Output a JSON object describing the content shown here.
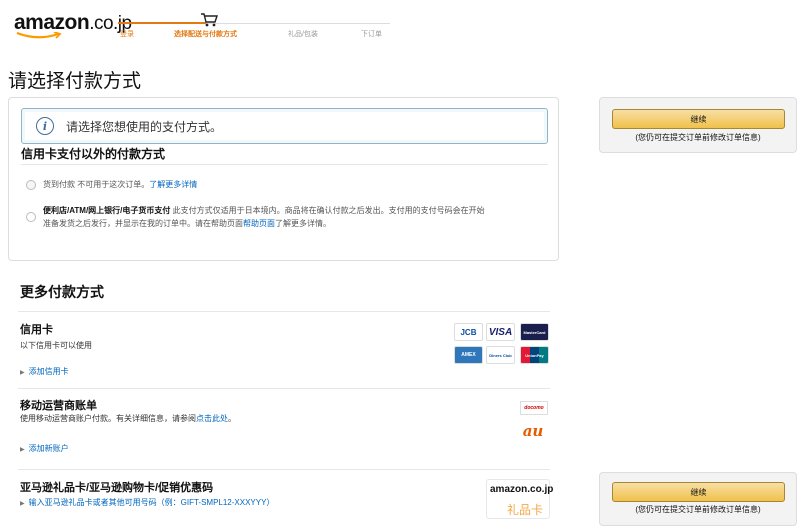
{
  "header": {
    "logo_main": "amazon",
    "logo_tld": ".co.jp",
    "steps": [
      "登录",
      "选择配送与付款方式",
      "礼品/包装",
      "下订单"
    ]
  },
  "page": {
    "title": "请选择付款方式"
  },
  "alert": {
    "text": "请选择您想使用的支付方式。"
  },
  "other_methods": {
    "heading": "信用卡支付以外的付款方式",
    "cod": {
      "label": "货到付款 不可用于这次订单。",
      "link": "了解更多详情"
    },
    "convenience": {
      "bold": "便利店/ATM/网上银行/电子货币支付",
      "text1": " 此支付方式仅适用于日本境内。商品将在确认付款之后发出。支付用的支付号码会在开始",
      "text2": "准备发货之后发行，并显示在我的订单中。请在帮助页面",
      "link": "帮助页面",
      "text3": "了解更多详情。"
    }
  },
  "more": {
    "title": "更多付款方式",
    "credit": {
      "title": "信用卡",
      "sub": "以下信用卡可以使用",
      "add": "添加信用卡",
      "brands": [
        "JCB",
        "VISA",
        "MasterCard",
        "AMEX",
        "Diners Club",
        "UnionPay"
      ]
    },
    "carrier": {
      "title": "移动运营商账单",
      "sub": "使用移动运营商账户付款。有关详细信息，请参阅",
      "sub_link": "点击此处",
      "sub_end": "。",
      "add": "添加新账户",
      "brand1": "docomo",
      "brand2": "au"
    },
    "gift": {
      "title": "亚马逊礼品卡/亚马逊购物卡/促销优惠码",
      "add": "输入亚马逊礼品卡或者其他可用号码（例：GIFT-SMPL12-XXXYYY）",
      "card_logo": "amazon.co.jp",
      "card_label": "礼品卡"
    }
  },
  "side": {
    "continue_label": "继续",
    "note": "(您仍可在提交订单前修改订单信息)"
  },
  "colors": {
    "accent": "#e47911",
    "link": "#0066c0",
    "button": "#f0c14b"
  }
}
